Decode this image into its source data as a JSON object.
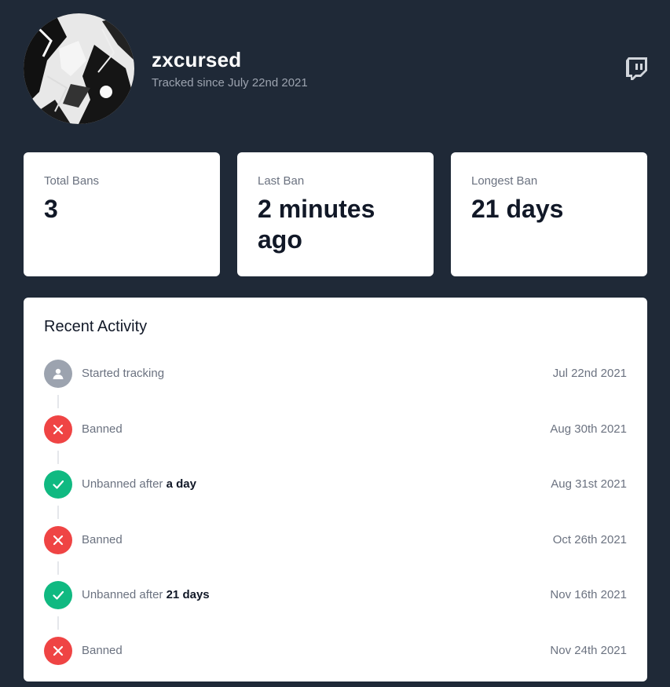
{
  "profile": {
    "name": "zxcursed",
    "tracked_since": "Tracked since July 22nd 2021",
    "avatar_icon": "user-avatar-image",
    "twitch_icon": "twitch-icon"
  },
  "stats": [
    {
      "label": "Total Bans",
      "value": "3"
    },
    {
      "label": "Last Ban",
      "value": "2 minutes ago"
    },
    {
      "label": "Longest Ban",
      "value": "21 days"
    }
  ],
  "activity": {
    "title": "Recent Activity",
    "events": [
      {
        "type": "tracking",
        "icon": "user-icon",
        "color": "#9ca3af",
        "text": "Started tracking",
        "duration": "",
        "date": "Jul 22nd 2021"
      },
      {
        "type": "ban",
        "icon": "x-icon",
        "color": "#ef4444",
        "text": "Banned",
        "duration": "",
        "date": "Aug 30th 2021"
      },
      {
        "type": "unban",
        "icon": "check-icon",
        "color": "#10b981",
        "text": "Unbanned after",
        "duration": "a day",
        "date": "Aug 31st 2021"
      },
      {
        "type": "ban",
        "icon": "x-icon",
        "color": "#ef4444",
        "text": "Banned",
        "duration": "",
        "date": "Oct 26th 2021"
      },
      {
        "type": "unban",
        "icon": "check-icon",
        "color": "#10b981",
        "text": "Unbanned after",
        "duration": "21 days",
        "date": "Nov 16th 2021"
      },
      {
        "type": "ban",
        "icon": "x-icon",
        "color": "#ef4444",
        "text": "Banned",
        "duration": "",
        "date": "Nov 24th 2021"
      }
    ]
  },
  "colors": {
    "background": "#1f2937",
    "card": "#ffffff",
    "ban": "#ef4444",
    "unban": "#10b981",
    "neutral": "#9ca3af"
  }
}
